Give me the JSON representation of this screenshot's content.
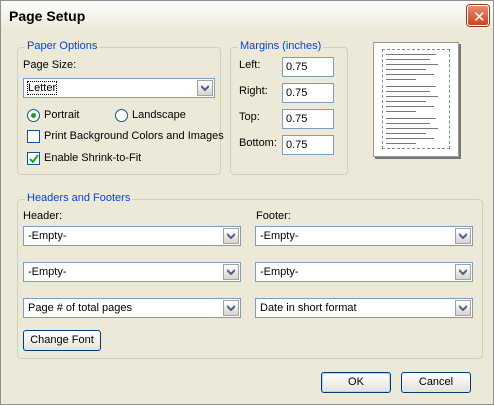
{
  "window": {
    "title": "Page Setup"
  },
  "paper_options": {
    "legend": "Paper Options",
    "page_size_label": "Page Size:",
    "page_size_value": "Letter",
    "portrait_label": "Portrait",
    "landscape_label": "Landscape",
    "portrait_selected": true,
    "print_bg_label": "Print Background Colors and Images",
    "print_bg_checked": false,
    "shrink_label": "Enable Shrink-to-Fit",
    "shrink_checked": true
  },
  "margins": {
    "legend": "Margins (inches)",
    "left_label": "Left:",
    "left_value": "0.75",
    "right_label": "Right:",
    "right_value": "0.75",
    "top_label": "Top:",
    "top_value": "0.75",
    "bottom_label": "Bottom:",
    "bottom_value": "0.75"
  },
  "headers_footers": {
    "legend": "Headers and Footers",
    "header_label": "Header:",
    "footer_label": "Footer:",
    "header_values": [
      "-Empty-",
      "-Empty-",
      "Page # of total pages"
    ],
    "footer_values": [
      "-Empty-",
      "-Empty-",
      "Date in short format"
    ],
    "change_font_label": "Change Font"
  },
  "buttons": {
    "ok": "OK",
    "cancel": "Cancel"
  },
  "icons": {
    "close": "close-icon",
    "dropdown": "chevron-down-icon",
    "check": "checkmark-icon"
  },
  "colors": {
    "legend_text": "#0046d5",
    "dialog_bg": "#ece9d8",
    "close_button": "#c24927"
  }
}
